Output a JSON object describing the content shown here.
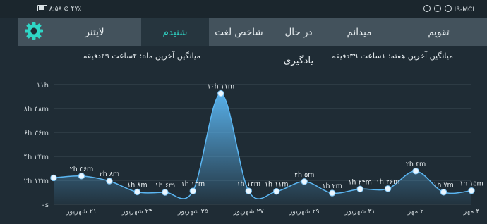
{
  "status_bar": {
    "left_text": "۸:۵۸ ⊘ ۴۷٪",
    "right_text": "IR-MCI"
  },
  "tabs": [
    {
      "label": "تقویم",
      "active": false
    },
    {
      "label": "میدانم",
      "active": false
    },
    {
      "label": "در حال یادگیری",
      "active": false
    },
    {
      "label": "شاخص لغت",
      "active": false
    },
    {
      "label": "شنیدم",
      "active": true
    },
    {
      "label": "لایتنر",
      "active": false
    }
  ],
  "settings_icon": "gear-icon",
  "colors": {
    "accent": "#2fd6c6",
    "tab_bar": "#43525c",
    "active_tab": "#26353e",
    "background": "#1f2c35",
    "line": "#5bb6f2",
    "point": "#eaf6ff"
  },
  "averages": {
    "week": "میانگین آخرین هفته: ۱ساعت ۳۹دقیقه",
    "month": "میانگین آخرین ماه: ۲ساعت ۲۹دقیقه"
  },
  "chart_data": {
    "type": "area",
    "y_unit": "minutes",
    "ylim": [
      0,
      660
    ],
    "y_ticks": [
      {
        "value": 0,
        "label": "۰s"
      },
      {
        "value": 132,
        "label": "۲h ۱۲m"
      },
      {
        "value": 264,
        "label": "۴h ۲۴m"
      },
      {
        "value": 396,
        "label": "۶h ۳۶m"
      },
      {
        "value": 528,
        "label": "۸h ۴۸m"
      },
      {
        "value": 660,
        "label": "۱۱h"
      }
    ],
    "x_labels": [
      {
        "index": 1,
        "label": "۲۱ شهریور"
      },
      {
        "index": 3,
        "label": "۲۳ شهریور"
      },
      {
        "index": 5,
        "label": "۲۵ شهریور"
      },
      {
        "index": 7,
        "label": "۲۷ شهریور"
      },
      {
        "index": 9,
        "label": "۲۹ شهریور"
      },
      {
        "index": 11,
        "label": "۳۱ شهریور"
      },
      {
        "index": 13,
        "label": "۲ مهر"
      },
      {
        "index": 15,
        "label": "۴ مهر"
      }
    ],
    "points": [
      {
        "value": 146,
        "label": ""
      },
      {
        "value": 156,
        "label": "۲h ۳۶m"
      },
      {
        "value": 128,
        "label": "۲h ۸m"
      },
      {
        "value": 68,
        "label": "۱h ۸m"
      },
      {
        "value": 66,
        "label": "۱h ۶m"
      },
      {
        "value": 73,
        "label": "۱h ۱۳m"
      },
      {
        "value": 611,
        "label": "۱۰h ۱۱m"
      },
      {
        "value": 73,
        "label": "۱h ۱۳m"
      },
      {
        "value": 71,
        "label": "۱h ۱۱m"
      },
      {
        "value": 125,
        "label": "۲h ۵m"
      },
      {
        "value": 62,
        "label": "۱h ۲m"
      },
      {
        "value": 84,
        "label": "۱h ۲۴m"
      },
      {
        "value": 86,
        "label": "۱h ۲۶m"
      },
      {
        "value": 183,
        "label": "۲h ۳m"
      },
      {
        "value": 67,
        "label": "۱h ۷m"
      },
      {
        "value": 75,
        "label": "۱h ۱۵m"
      }
    ]
  }
}
